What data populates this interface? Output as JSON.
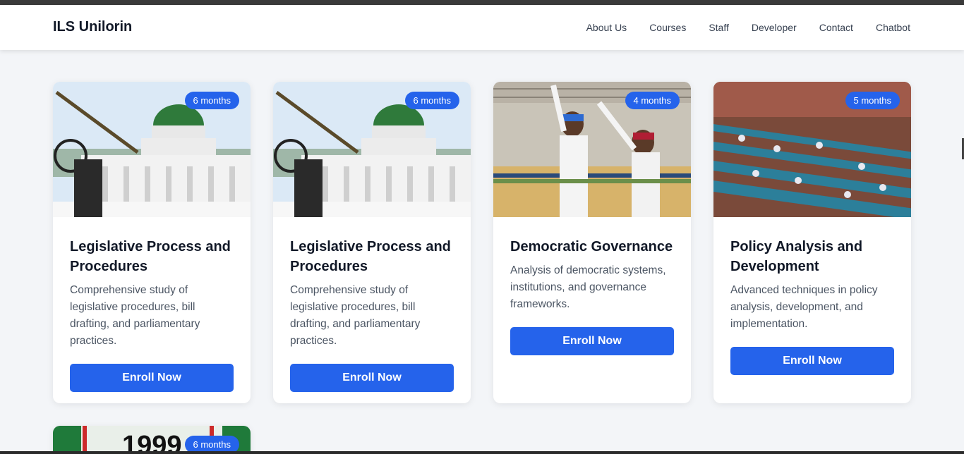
{
  "brand": "ILS Unilorin",
  "nav": [
    "About Us",
    "Courses",
    "Staff",
    "Developer",
    "Contact",
    "Chatbot"
  ],
  "courses": [
    {
      "duration": "6 months",
      "title": "Legislative Process and Procedures",
      "description": "Comprehensive study of legislative procedures, bill drafting, and parliamentary practices.",
      "button": "Enroll Now",
      "image": "national-assembly-photo"
    },
    {
      "duration": "6 months",
      "title": "Legislative Process and Procedures",
      "description": "Comprehensive study of legislative procedures, bill drafting, and parliamentary practices.",
      "button": "Enroll Now",
      "image": "national-assembly-photo"
    },
    {
      "duration": "4 months",
      "title": "Democratic Governance",
      "description": "Analysis of democratic systems, institutions, and governance frameworks.",
      "button": "Enroll Now",
      "image": "politicians-waving-photo"
    },
    {
      "duration": "5 months",
      "title": "Policy Analysis and Development",
      "description": "Advanced techniques in policy analysis, development, and implementation.",
      "button": "Enroll Now",
      "image": "legislative-chamber-photo"
    },
    {
      "duration": "6 months",
      "image_text": "1999",
      "image": "constitution-1999-photo"
    }
  ],
  "colors": {
    "primary": "#2563eb",
    "background": "#f3f5f8",
    "green": "#1f7a3a"
  }
}
